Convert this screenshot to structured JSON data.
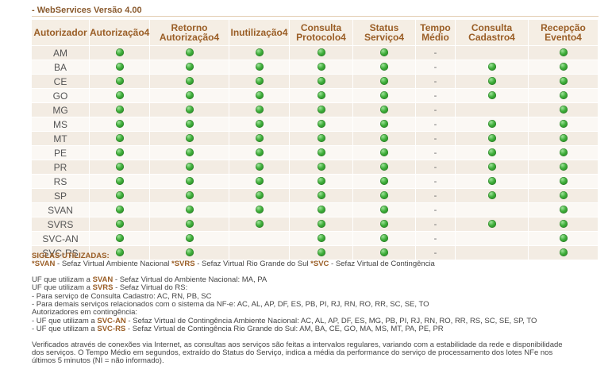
{
  "header": {
    "title": "- WebServices Versão 4.00"
  },
  "table": {
    "columns": [
      "Autorizador",
      "Autorização4",
      "Retorno Autorização4",
      "Inutilização4",
      "Consulta Protocolo4",
      "Status Serviço4",
      "Tempo Médio",
      "Consulta Cadastro4",
      "Recepção Evento4"
    ],
    "rows": [
      {
        "uf": "AM",
        "cells": [
          "ok",
          "ok",
          "ok",
          "ok",
          "ok",
          "-",
          "",
          "ok"
        ]
      },
      {
        "uf": "BA",
        "cells": [
          "ok",
          "ok",
          "ok",
          "ok",
          "ok",
          "-",
          "ok",
          "ok"
        ]
      },
      {
        "uf": "CE",
        "cells": [
          "ok",
          "ok",
          "ok",
          "ok",
          "ok",
          "-",
          "ok",
          "ok"
        ]
      },
      {
        "uf": "GO",
        "cells": [
          "ok",
          "ok",
          "ok",
          "ok",
          "ok",
          "-",
          "ok",
          "ok"
        ]
      },
      {
        "uf": "MG",
        "cells": [
          "ok",
          "ok",
          "ok",
          "ok",
          "ok",
          "-",
          "",
          "ok"
        ]
      },
      {
        "uf": "MS",
        "cells": [
          "ok",
          "ok",
          "ok",
          "ok",
          "ok",
          "-",
          "ok",
          "ok"
        ]
      },
      {
        "uf": "MT",
        "cells": [
          "ok",
          "ok",
          "ok",
          "ok",
          "ok",
          "-",
          "ok",
          "ok"
        ]
      },
      {
        "uf": "PE",
        "cells": [
          "ok",
          "ok",
          "ok",
          "ok",
          "ok",
          "-",
          "ok",
          "ok"
        ]
      },
      {
        "uf": "PR",
        "cells": [
          "ok",
          "ok",
          "ok",
          "ok",
          "ok",
          "-",
          "ok",
          "ok"
        ]
      },
      {
        "uf": "RS",
        "cells": [
          "ok",
          "ok",
          "ok",
          "ok",
          "ok",
          "-",
          "ok",
          "ok"
        ]
      },
      {
        "uf": "SP",
        "cells": [
          "ok",
          "ok",
          "ok",
          "ok",
          "ok",
          "-",
          "ok",
          "ok"
        ]
      },
      {
        "uf": "SVAN",
        "cells": [
          "ok",
          "ok",
          "ok",
          "ok",
          "ok",
          "-",
          "",
          "ok"
        ]
      },
      {
        "uf": "SVRS",
        "cells": [
          "ok",
          "ok",
          "ok",
          "ok",
          "ok",
          "-",
          "ok",
          "ok"
        ]
      },
      {
        "uf": "SVC-AN",
        "cells": [
          "ok",
          "ok",
          "",
          "ok",
          "ok",
          "-",
          "",
          "ok"
        ]
      },
      {
        "uf": "SVC-RS",
        "cells": [
          "ok",
          "ok",
          "",
          "ok",
          "ok",
          "-",
          "",
          "ok"
        ]
      }
    ],
    "status_icon": "green-status-dot-icon",
    "dash_text": "-"
  },
  "notes": {
    "siglas_title": "SIGLAS UTILIZADAS:",
    "legend": [
      {
        "code": "*SVAN",
        "text": " - Sefaz Virtual Ambiente Nacional "
      },
      {
        "code": "*SVRS",
        "text": " - Sefaz Virtual Rio Grande do Sul "
      },
      {
        "code": "*SVC",
        "text": " - Sefaz Virtual de Contingência"
      }
    ],
    "svan_prefix": "UF que utilizam a ",
    "svan_code": "SVAN",
    "svan_text": " - Sefaz Virtual do Ambiente Nacional: MA, PA",
    "svrs_prefix": "UF que utilizam a ",
    "svrs_code": "SVRS",
    "svrs_text": " - Sefaz Virtual do RS:",
    "svrs_line1": "- Para serviço de Consulta Cadastro: AC, RN, PB, SC",
    "svrs_line2": "- Para demais serviços relacionados com o sistema da NF-e: AC, AL, AP, DF, ES, PB, PI, RJ, RN, RO, RR, SC, SE, TO",
    "contingencia_title": "Autorizadores em contingência:",
    "svcan_prefix": "- UF que utilizam a ",
    "svcan_code": "SVC-AN",
    "svcan_text": " - Sefaz Virtual de Contingência Ambiente Nacional: AC, AL, AP, DF, ES, MG, PB, PI, RJ, RN, RO, RR, RS, SC, SE, SP, TO",
    "svcrs_prefix": "- UF que utilizam a ",
    "svcrs_code": "SVC-RS",
    "svcrs_text": " - Sefaz Virtual de Contingência Rio Grande do Sul: AM, BA, CE, GO, MA, MS, MT, PA, PE, PR",
    "footer1": "Verificados através de conexões via Internet, as consultas aos serviços são feitas a intervalos regulares, variando com a estabilidade da rede e disponibilidade",
    "footer2": "dos serviços. O Tempo Médio em segundos, extraído do Status do Serviço, indica a média da performance do serviço de processamento dos lotes NFe nos",
    "footer3": "últimos 5 minutos (NI = não informado)."
  }
}
